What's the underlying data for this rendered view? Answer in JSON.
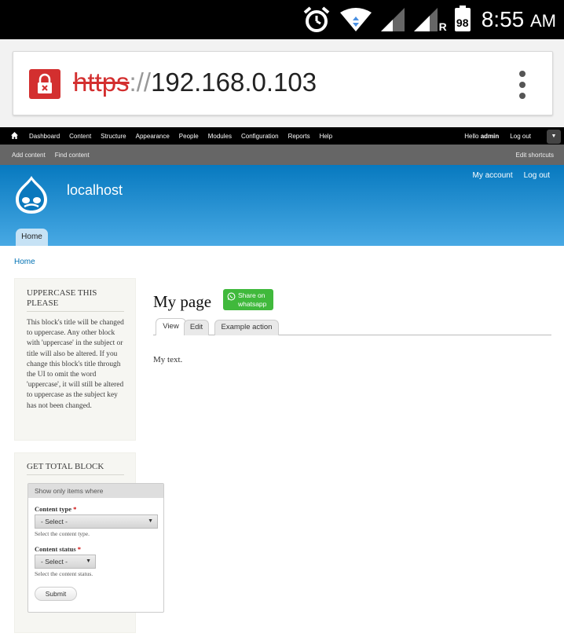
{
  "status_bar": {
    "time": "8:55",
    "ampm": "AM",
    "battery": "98",
    "network_letter": "R",
    "icons": [
      "alarm-icon",
      "wifi-icon",
      "signal-icon",
      "signal-roaming-icon",
      "battery-icon"
    ]
  },
  "browser": {
    "url_scheme": "https",
    "url_separator": "://",
    "url_host": "192.168.0.103",
    "icons": [
      "insecure-lock-icon",
      "overflow-menu-icon"
    ],
    "accent_color": "#d32f2f"
  },
  "admin_toolbar": {
    "menu": [
      "Dashboard",
      "Content",
      "Structure",
      "Appearance",
      "People",
      "Modules",
      "Configuration",
      "Reports",
      "Help"
    ],
    "hello": "Hello",
    "user": "admin",
    "logout": "Log out"
  },
  "shortcuts": {
    "items": [
      "Add content",
      "Find content"
    ],
    "edit": "Edit shortcuts"
  },
  "header": {
    "site_name": "localhost",
    "secondary_menu": [
      "My account",
      "Log out"
    ],
    "main_tab": "Home",
    "gradient": [
      "#0779bf",
      "#48a9e4"
    ]
  },
  "breadcrumb": "Home",
  "sidebar": {
    "block1": {
      "title": "UPPERCASE THIS PLEASE",
      "body": "This block's title will be changed to uppercase. Any other block with 'uppercase' in the subject or title will also be altered. If you change this block's title through the UI to omit the word 'uppercase', it will still be altered to uppercase as the subject key has not been changed."
    },
    "block2": {
      "title": "GET TOTAL BLOCK",
      "legend": "Show only items where",
      "content_type_label": "Content type",
      "content_type_value": "- Select -",
      "content_type_desc": "Select the content type.",
      "content_status_label": "Content status",
      "content_status_value": "- Select -",
      "content_status_desc": "Select the content status.",
      "required_mark": "*",
      "submit": "Submit"
    }
  },
  "main": {
    "title": "My page",
    "share_line1": "Share on",
    "share_line2": "whatsapp",
    "tabs": [
      "View",
      "Edit",
      "Example action"
    ],
    "content": "My text.",
    "share_color": "#40b93c"
  }
}
